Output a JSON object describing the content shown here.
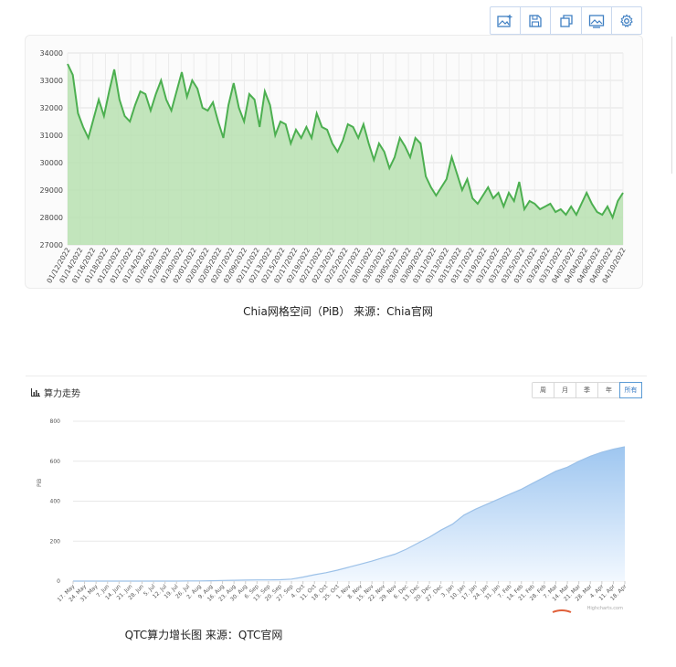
{
  "toolbar": {
    "buttons": [
      {
        "icon": "image-add-icon"
      },
      {
        "icon": "save-icon"
      },
      {
        "icon": "copy-icon"
      },
      {
        "icon": "image-icon"
      },
      {
        "icon": "gear-icon"
      }
    ]
  },
  "captions": {
    "chart1": "Chia网格空间（PiB） 来源：Chia官网",
    "chart2": "QTC算力增长图  来源：QTC官网"
  },
  "panel2": {
    "title": "算力走势",
    "periods": [
      "周",
      "月",
      "季",
      "年",
      "所有"
    ],
    "active_period": "所有",
    "credit": "Highcharts.com"
  },
  "colors": {
    "chia_line": "#4caf50",
    "chia_fill": "#b7e0b0",
    "qtc_line": "#9cc1e8",
    "qtc_fill_top": "#9ec6f0",
    "qtc_fill_bottom": "#f2f8ff",
    "toolbar_icon": "#3f7fc2"
  },
  "chart_data": [
    {
      "type": "area",
      "title": "",
      "xlabel": "",
      "ylabel": "",
      "ylim": [
        27000,
        34000
      ],
      "yticks": [
        27000,
        28000,
        29000,
        30000,
        31000,
        32000,
        33000,
        34000
      ],
      "grid": true,
      "x_tick_labels": [
        "01/12/2022",
        "01/14/2022",
        "01/16/2022",
        "01/18/2022",
        "01/20/2022",
        "01/22/2022",
        "01/24/2022",
        "01/26/2022",
        "01/28/2022",
        "01/30/2022",
        "02/01/2022",
        "02/03/2022",
        "02/05/2022",
        "02/07/2022",
        "02/09/2022",
        "02/11/2022",
        "02/13/2022",
        "02/15/2022",
        "02/17/2022",
        "02/19/2022",
        "02/21/2022",
        "02/23/2022",
        "02/25/2022",
        "02/27/2022",
        "03/01/2022",
        "03/03/2022",
        "03/05/2022",
        "03/07/2022",
        "03/09/2022",
        "03/11/2022",
        "03/13/2022",
        "03/15/2022",
        "03/17/2022",
        "03/19/2022",
        "03/21/2022",
        "03/23/2022",
        "03/25/2022",
        "03/27/2022",
        "03/29/2022",
        "03/31/2022",
        "04/02/2022",
        "04/04/2022",
        "04/06/2022",
        "04/08/2022",
        "04/10/2022"
      ],
      "series": [
        {
          "values": [
            33600,
            33200,
            31800,
            31300,
            30900,
            31600,
            32300,
            31700,
            32600,
            33400,
            32300,
            31700,
            31500,
            32100,
            32600,
            32500,
            31900,
            32500,
            33000,
            32300,
            31900,
            32600,
            33300,
            32400,
            33000,
            32700,
            32000,
            31900,
            32200,
            31500,
            30900,
            32100,
            32900,
            32000,
            31500,
            32500,
            32300,
            31300,
            32600,
            32100,
            31000,
            31500,
            31400,
            30700,
            31200,
            30900,
            31300,
            30900,
            31800,
            31300,
            31200,
            30700,
            30400,
            30800,
            31400,
            31300,
            30900,
            31400,
            30700,
            30100,
            30700,
            30400,
            29800,
            30200,
            30900,
            30600,
            30200,
            30900,
            30700,
            29500,
            29100,
            28800,
            29100,
            29400,
            30200,
            29600,
            29000,
            29400,
            28700,
            28500,
            28800,
            29100,
            28700,
            28900,
            28400,
            28900,
            28600,
            29300,
            28300,
            28600,
            28500,
            28300,
            28400,
            28500,
            28200,
            28300,
            28100,
            28400,
            28100,
            28500,
            28900,
            28500,
            28200,
            28100,
            28400,
            28000,
            28600,
            28900
          ]
        }
      ]
    },
    {
      "type": "area",
      "title": "",
      "xlabel": "",
      "ylabel": "PiB",
      "ylim": [
        0,
        800
      ],
      "yticks": [
        0,
        200,
        400,
        600,
        800
      ],
      "grid": true,
      "categories": [
        "17. May",
        "24. May",
        "31. May",
        "7. Jun",
        "14. Jun",
        "21. Jun",
        "28. Jun",
        "5. Jul",
        "12. Jul",
        "19. Jul",
        "26. Jul",
        "2. Aug",
        "9. Aug",
        "16. Aug",
        "23. Aug",
        "30. Aug",
        "6. Sep",
        "13. Sep",
        "20. Sep",
        "27. Sep",
        "4. Oct",
        "11. Oct",
        "18. Oct",
        "25. Oct",
        "1. Nov",
        "8. Nov",
        "15. Nov",
        "22. Nov",
        "29. Nov",
        "6. Dec",
        "13. Dec",
        "20. Dec",
        "27. Dec",
        "3. Jan",
        "10. Jan",
        "17. Jan",
        "24. Jan",
        "31. Jan",
        "7. Feb",
        "14. Feb",
        "21. Feb",
        "28. Feb",
        "7. Mar",
        "14. Mar",
        "21. Mar",
        "28. Mar",
        "4. Apr",
        "11. Apr",
        "18. Apr"
      ],
      "series": [
        {
          "name": "",
          "values": [
            0,
            0,
            0,
            0,
            0,
            0,
            0,
            0,
            0,
            0,
            1,
            1,
            2,
            3,
            4,
            5,
            6,
            6,
            7,
            10,
            20,
            32,
            42,
            55,
            70,
            85,
            100,
            118,
            135,
            160,
            190,
            220,
            255,
            285,
            330,
            360,
            385,
            410,
            435,
            460,
            490,
            520,
            550,
            570,
            600,
            625,
            645,
            660,
            672
          ]
        }
      ]
    }
  ]
}
